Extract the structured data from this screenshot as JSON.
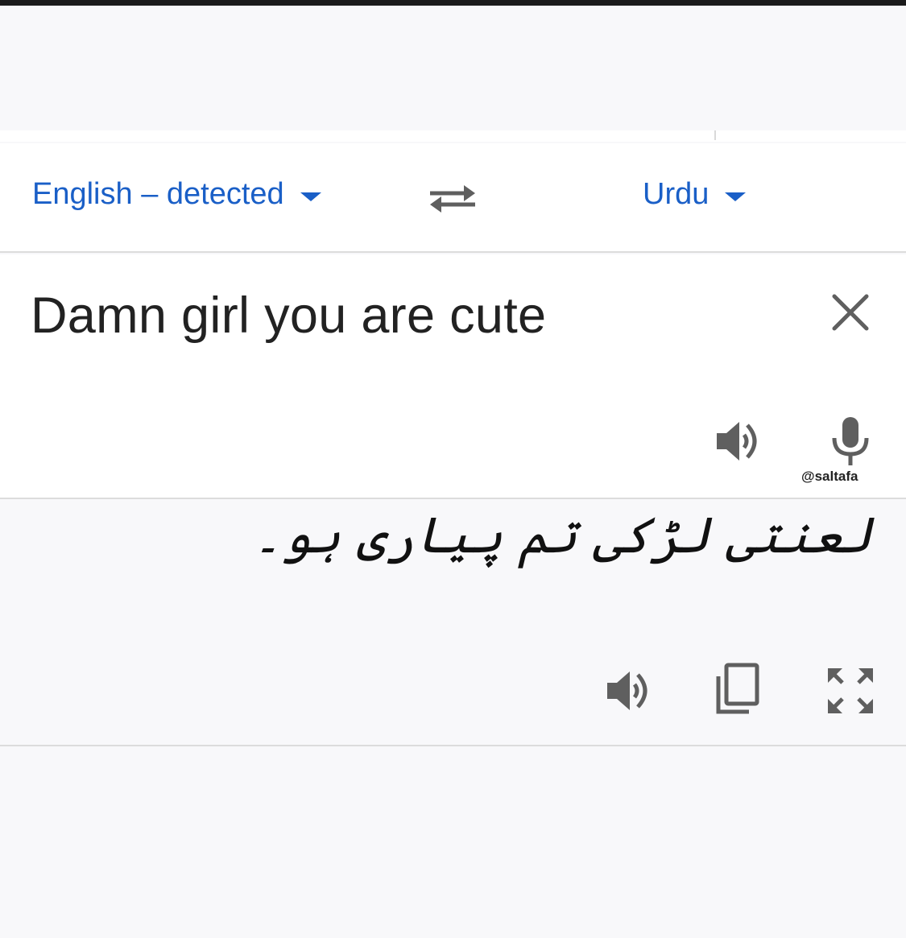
{
  "language_bar": {
    "source_language": "English – detected",
    "target_language": "Urdu"
  },
  "source": {
    "text": "Damn girl you are cute"
  },
  "watermark": "@saltafa",
  "translation": {
    "text": "لعنتی لڑکی تم پیاری ہو۔"
  },
  "icons": [
    "swap-icon",
    "close-icon",
    "speaker-icon",
    "microphone-icon",
    "copy-icon",
    "fullscreen-icon",
    "dropdown-caret-icon"
  ],
  "colors": {
    "accent": "#1a5fc7",
    "icon": "#5f5f5f",
    "text": "#222222",
    "divider": "#dcdcdc",
    "page_background": "#f8f8fa"
  }
}
